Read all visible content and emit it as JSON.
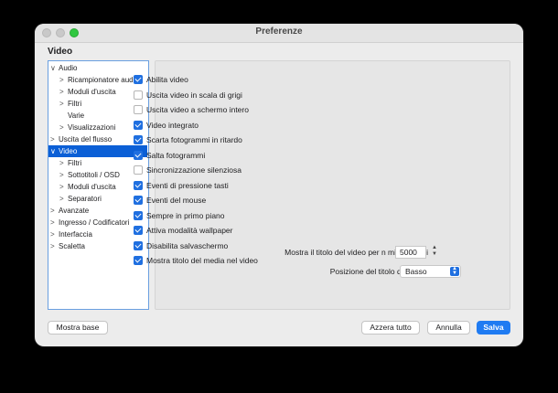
{
  "window": {
    "title": "Preferenze"
  },
  "section_title": "Video",
  "tree": [
    {
      "label": "Audio",
      "chevron": "∨",
      "indent": 0
    },
    {
      "label": "Ricampionatore audio",
      "chevron": ">",
      "indent": 1
    },
    {
      "label": "Moduli d'uscita",
      "chevron": ">",
      "indent": 1
    },
    {
      "label": "Filtri",
      "chevron": ">",
      "indent": 1
    },
    {
      "label": "Varie",
      "chevron": "",
      "indent": 1
    },
    {
      "label": "Visualizzazioni",
      "chevron": ">",
      "indent": 1
    },
    {
      "label": "Uscita del flusso",
      "chevron": ">",
      "indent": 0
    },
    {
      "label": "Video",
      "chevron": "∨",
      "indent": 0,
      "selected": true
    },
    {
      "label": "Filtri",
      "chevron": ">",
      "indent": 1
    },
    {
      "label": "Sottotitoli / OSD",
      "chevron": ">",
      "indent": 1
    },
    {
      "label": "Moduli d'uscita",
      "chevron": ">",
      "indent": 1
    },
    {
      "label": "Separatori",
      "chevron": ">",
      "indent": 1
    },
    {
      "label": "Avanzate",
      "chevron": ">",
      "indent": 0
    },
    {
      "label": "Ingresso / Codificatori",
      "chevron": ">",
      "indent": 0
    },
    {
      "label": "Interfaccia",
      "chevron": ">",
      "indent": 0
    },
    {
      "label": "Scaletta",
      "chevron": ">",
      "indent": 0
    }
  ],
  "options": [
    {
      "label": "Abilita video",
      "checked": true
    },
    {
      "label": "Uscita video in scala di grigi",
      "checked": false
    },
    {
      "label": "Uscita video a schermo intero",
      "checked": false
    },
    {
      "label": "Video integrato",
      "checked": true
    },
    {
      "label": "Scarta fotogrammi in ritardo",
      "checked": true
    },
    {
      "label": "Salta fotogrammi",
      "checked": true
    },
    {
      "label": "Sincronizzazione silenziosa",
      "checked": false
    },
    {
      "label": "Eventi di pressione tasti",
      "checked": true
    },
    {
      "label": "Eventi del mouse",
      "checked": true
    },
    {
      "label": "Sempre in primo piano",
      "checked": true
    },
    {
      "label": "Attiva modalità wallpaper",
      "checked": true
    },
    {
      "label": "Disabilita salvaschermo",
      "checked": true
    },
    {
      "label": "Mostra titolo del media nel video",
      "checked": true
    }
  ],
  "title_duration": {
    "label": "Mostra il titolo del video per n millisecondi",
    "value": "5000"
  },
  "title_position": {
    "label": "Posizione del titolo del video",
    "value": "Basso"
  },
  "buttons": {
    "show_basic": "Mostra base",
    "reset_all": "Azzera tutto",
    "cancel": "Annulla",
    "save": "Salva"
  },
  "colors": {
    "accent": "#1f7bf2",
    "selection": "#0b5fd6"
  }
}
